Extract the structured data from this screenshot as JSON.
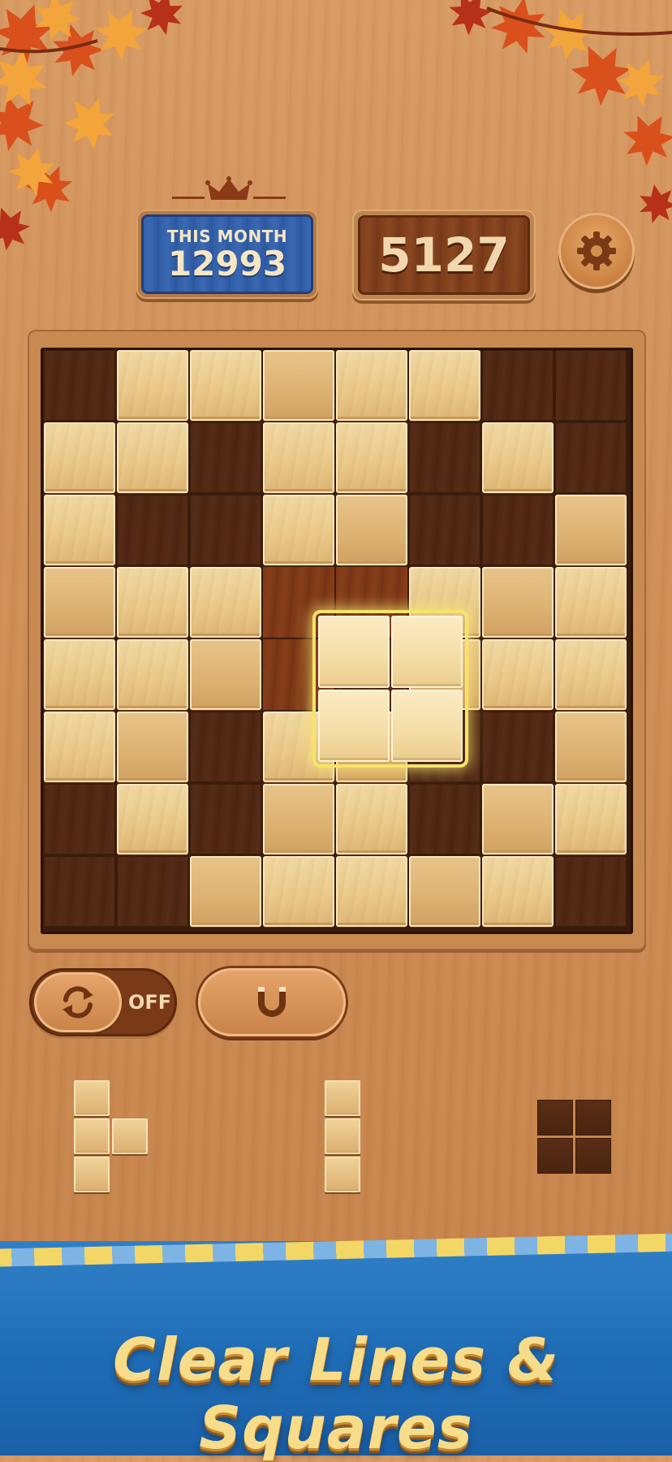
{
  "header": {
    "month_label": "THIS MONTH",
    "month_score": "12993",
    "current_score": "5127"
  },
  "board": {
    "rows": 8,
    "cols": 8,
    "cells": [
      [
        0,
        1,
        1,
        1,
        1,
        1,
        0,
        0
      ],
      [
        1,
        1,
        0,
        1,
        1,
        0,
        1,
        0
      ],
      [
        1,
        0,
        0,
        1,
        1,
        0,
        0,
        1
      ],
      [
        1,
        1,
        1,
        0,
        0,
        1,
        1,
        1
      ],
      [
        1,
        1,
        1,
        0,
        0,
        1,
        1,
        1
      ],
      [
        1,
        1,
        0,
        1,
        1,
        0,
        0,
        1
      ],
      [
        0,
        1,
        0,
        1,
        1,
        0,
        1,
        1
      ],
      [
        0,
        0,
        1,
        1,
        1,
        1,
        1,
        0
      ]
    ],
    "highlighted_cells": [
      [
        3,
        3
      ],
      [
        3,
        4
      ],
      [
        4,
        3
      ]
    ],
    "dragged_piece": "2x2 square"
  },
  "tools": {
    "rotate_toggle_state": "OFF",
    "rotate_icon": "rotate-icon",
    "magnet_icon": "magnet-icon"
  },
  "tray": {
    "pieces": [
      {
        "name": "t-piece",
        "color": "#e6c384"
      },
      {
        "name": "i3-piece",
        "color": "#e6c384"
      },
      {
        "name": "square-piece",
        "color": "#4e2713"
      }
    ]
  },
  "banner": {
    "text": "Clear Lines & Squares",
    "text_color": "#f7dc8a",
    "background_color": "#2373bc"
  },
  "icons": {
    "settings": "gear-icon",
    "crown": "crown-icon",
    "decor": "autumn-leaves"
  }
}
